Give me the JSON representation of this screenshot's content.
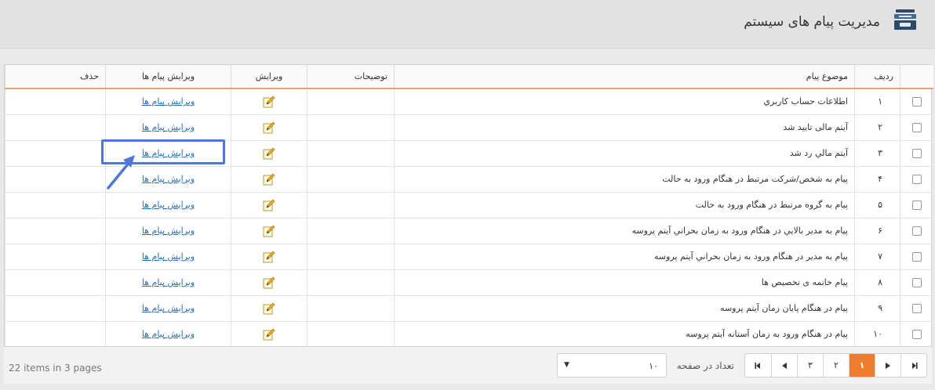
{
  "header": {
    "title": "مدیریت پیام های سیستم",
    "icon": "inbox-stack-icon"
  },
  "grid": {
    "columns": {
      "row": "ردیف",
      "subject": "موضوع پیام",
      "description": "توضیحات",
      "edit": "ویرایش",
      "edit_messages": "ویرایش پیام ها",
      "delete": "حذف"
    },
    "rows": [
      {
        "num": "۱",
        "subject": "اطلاعات حساب کاربري",
        "link": "ویرایش پیام ها"
      },
      {
        "num": "۲",
        "subject": "آیتم مالی تایید شد",
        "link": "ویرایش پیام ها"
      },
      {
        "num": "۳",
        "subject": "آیتم مالي رد شد",
        "link": "ویرایش پیام ها"
      },
      {
        "num": "۴",
        "subject": "پیام به شخص/شرکت مرتبط در هنگام ورود به حالت",
        "link": "ویرایش پیام ها"
      },
      {
        "num": "۵",
        "subject": "پیام به گروه مرتبط در هنگام ورود به حالت",
        "link": "ویرایش پیام ها"
      },
      {
        "num": "۶",
        "subject": "پیام به مدیر بالایي در هنگام ورود به زمان بحراني آیتم پروسه",
        "link": "ویرایش پیام ها"
      },
      {
        "num": "۷",
        "subject": "پیام به مدیر در هنگام ورود به زمان بحراني آیتم پروسه",
        "link": "ویرایش پیام ها"
      },
      {
        "num": "۸",
        "subject": "پیام خاتمه ی تخصیص ها",
        "link": "ویرایش پیام ها"
      },
      {
        "num": "۹",
        "subject": "پیام در هنگام پایان زمان آیتم پروسه",
        "link": "ویرایش پیام ها"
      },
      {
        "num": "۱۰",
        "subject": "پیام در هنگام ورود به زمان آستانه آیتم پروسه",
        "link": "ویرایش پیام ها"
      }
    ]
  },
  "footer": {
    "items_info": "22 items in 3 pages",
    "per_page_label": "تعداد در صفحه",
    "per_page_value": "۱۰",
    "pages": [
      "۱",
      "۲",
      "۳"
    ],
    "active_page": "۱"
  },
  "colors": {
    "accent": "#ef7d2e",
    "link": "#2a6fb0",
    "highlight": "#4f78d6"
  }
}
